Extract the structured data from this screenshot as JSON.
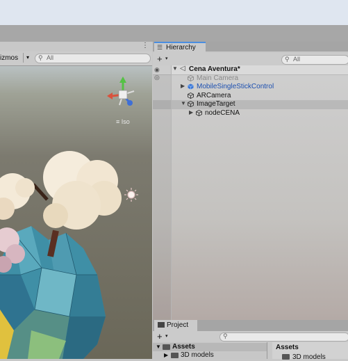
{
  "scene": {
    "gizmos_label": "izmos",
    "gizmos_dropdown_glyph": "▾",
    "search_placeholder": "All",
    "iso_label": "≡ Iso",
    "menu_glyph": "⋮"
  },
  "hierarchy": {
    "tab_label": "Hierarchy",
    "add_glyph": "+",
    "add_caret": "▾",
    "search_placeholder": "All",
    "items": [
      {
        "label": "Cena Aventura*",
        "expanded": true
      },
      {
        "label": "Main Camera",
        "disabled": true
      },
      {
        "label": "MobileSingleStickControl",
        "prefab": true,
        "collapsed": true
      },
      {
        "label": "ARCamera"
      },
      {
        "label": "ImageTarget",
        "expanded": true
      },
      {
        "label": "nodeCENA",
        "collapsed": true
      }
    ]
  },
  "project": {
    "tab_label": "Project",
    "add_glyph": "+",
    "add_caret": "▾",
    "tree": [
      {
        "label": "Assets"
      },
      {
        "label": "3D models"
      }
    ],
    "right_header": "Assets",
    "right_item": "3D models"
  },
  "colors": {
    "accent": "#4a8ee0",
    "prefab_blue": "#1b4fb0",
    "tree_foliage": "#f4ead8",
    "rock_teal": "#3f8fa6"
  },
  "icons": {
    "search": "search-icon",
    "eye": "eye-icon",
    "cube": "gameobject-cube-icon",
    "prefab": "prefab-cube-icon",
    "folder": "folder-icon",
    "light": "light-icon",
    "gizmo": "orientation-gizmo-icon"
  }
}
